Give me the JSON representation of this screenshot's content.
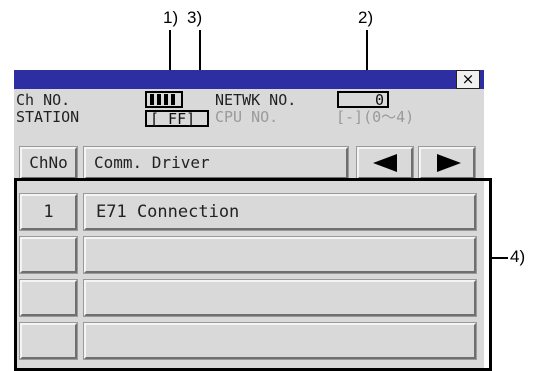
{
  "callouts": {
    "c1": "1)",
    "c2": "2)",
    "c3": "3)",
    "c4": "4)"
  },
  "window": {
    "close_label": "×"
  },
  "fields": {
    "ch_no_label": "Ch NO.",
    "station_label": "STATION",
    "station_value": "[ FF]",
    "netwk_label": "NETWK NO.",
    "netwk_value": "0",
    "cpu_label": "CPU NO.",
    "cpu_value": "[-](0〜4)"
  },
  "table": {
    "headers": {
      "chno": "ChNo",
      "driver": "Comm. Driver"
    },
    "rows": [
      {
        "chno": "1",
        "driver": "E71 Connection"
      },
      {
        "chno": "",
        "driver": ""
      },
      {
        "chno": "",
        "driver": ""
      },
      {
        "chno": "",
        "driver": ""
      }
    ]
  },
  "icons": {
    "prev": "left-arrow-icon",
    "next": "right-arrow-icon",
    "close": "close-icon"
  }
}
